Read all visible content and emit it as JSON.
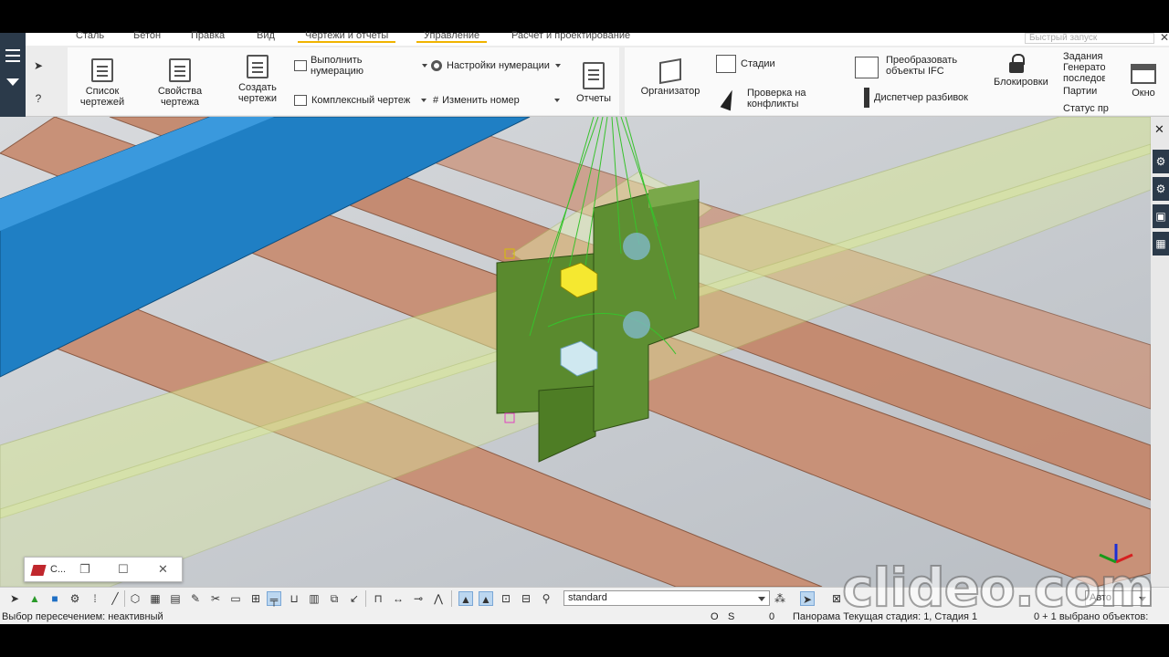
{
  "ribbon": {
    "tabs": [
      "Сталь",
      "Бетон",
      "Правка",
      "Вид",
      "Чертежи и отчеты",
      "Управление",
      "Расчет и проектирование"
    ],
    "active_tab": "Чертежи и отчеты",
    "quick_launch_placeholder": "Быстрый запуск",
    "buttons": {
      "drawing_list": "Список чертежей",
      "drawing_props": "Свойства чертежа",
      "create_drawing": "Создать чертежи",
      "perform_numbering": "Выполнить нумерацию",
      "numbering_settings": "Настройки нумерации",
      "complex_drawing": "Комплексный чертеж",
      "change_number": "Изменить номер",
      "reports": "Отчеты",
      "organizer": "Организатор",
      "stages": "Стадии",
      "clash_check": "Проверка на конфликты",
      "convert_ifc": "Преобразовать объекты IFC",
      "layout_manager": "Диспетчер разбивок",
      "locks": "Блокировки",
      "tasks": "Задания",
      "generator": "Генератор последовательностей",
      "lots": "Партии",
      "status": "Статус пр",
      "window": "Окно"
    }
  },
  "miniwin": {
    "title": "С..."
  },
  "toolbar": {
    "standard_combo": "standard",
    "auto_combo": "Авто"
  },
  "status": {
    "selection_mode": "Выбор пересечением: неактивный",
    "o_label": "O",
    "s_label": "S",
    "zero": "0",
    "stage": "Панорама Текущая стадия: 1, Стадия 1",
    "selected": "0 + 1 выбрано объектов:"
  },
  "watermark": "clideo.com",
  "colors": {
    "ribbon_bg": "#ececec",
    "left_strip": "#2b3a4a",
    "beam_blue": "#1f7fc4",
    "beam_brown": "#c89178",
    "plate_green": "#5a8a2e",
    "transparent_yellow": "#d9e89a",
    "active_tab_underline": "#f0b400"
  }
}
